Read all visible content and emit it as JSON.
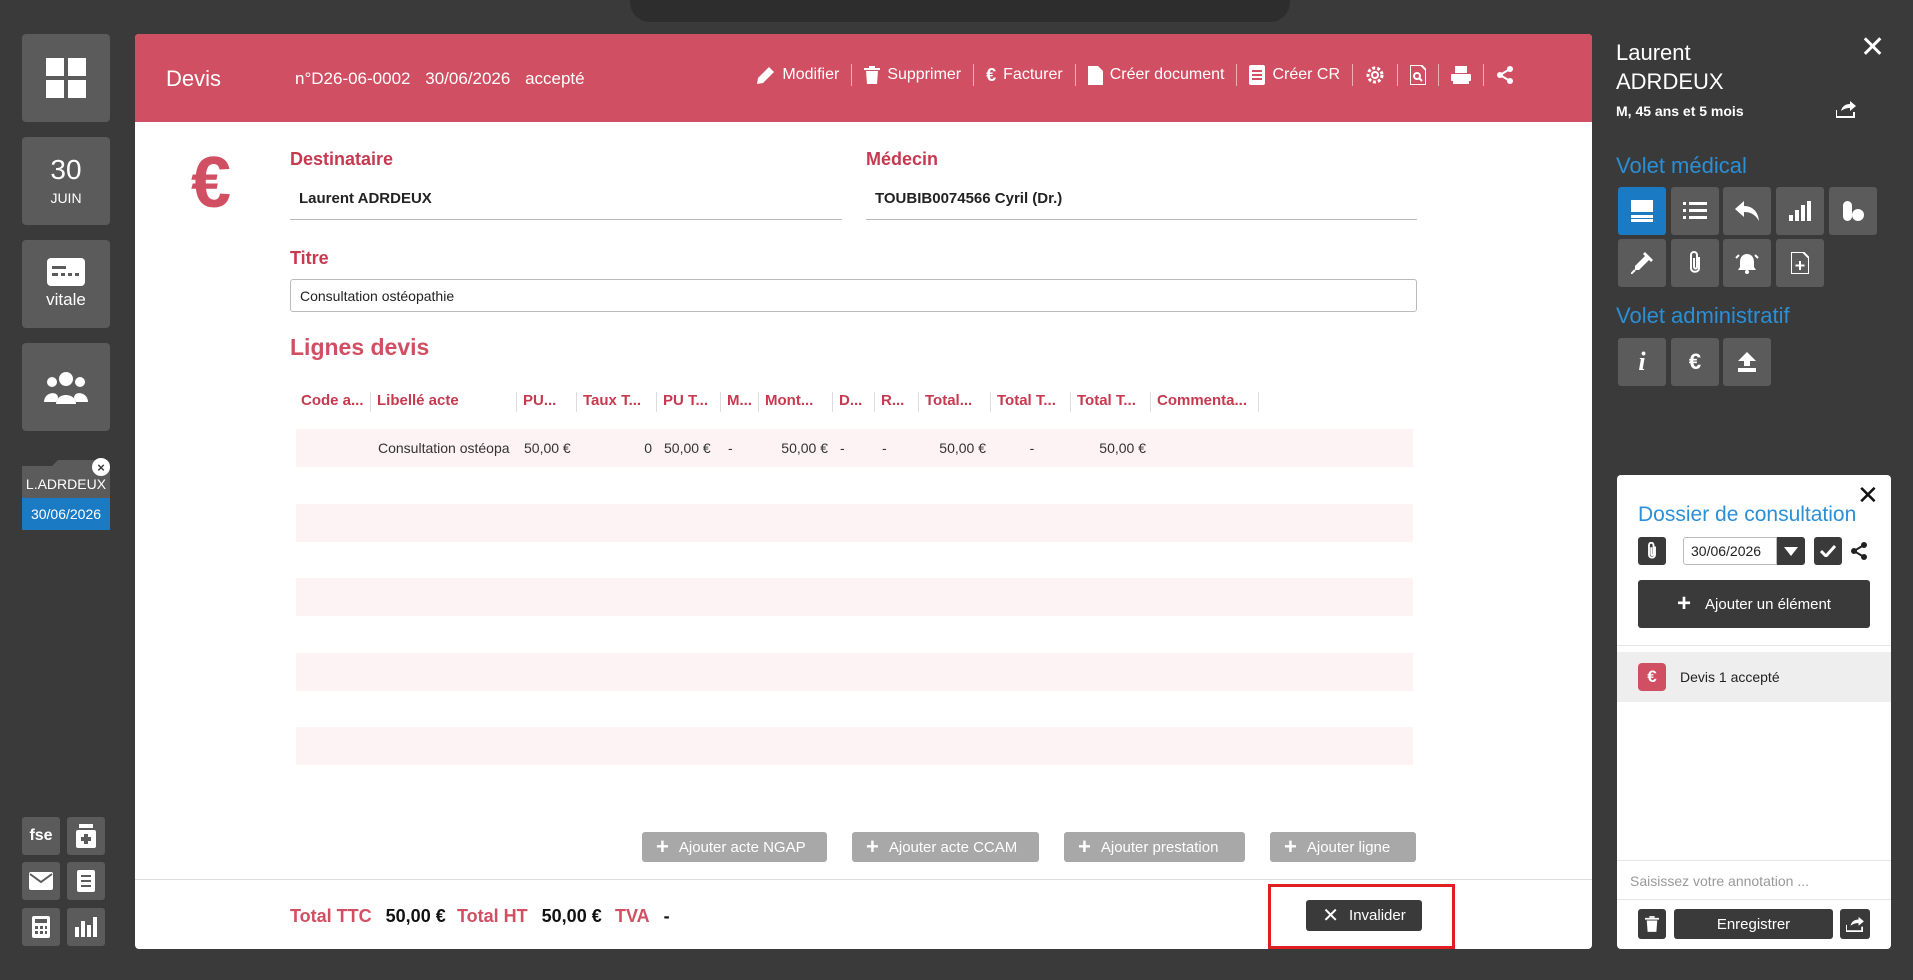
{
  "left_nav": {
    "day": "30",
    "month": "JUIN",
    "vitale_label": "vitale",
    "folder": {
      "name": "L.ADRDEUX",
      "date": "30/06/2026"
    },
    "fse_label": "fse"
  },
  "header": {
    "title": "Devis",
    "number": "n°D26-06-0002",
    "date": "30/06/2026",
    "status": "accepté",
    "actions": {
      "modifier": "Modifier",
      "supprimer": "Supprimer",
      "facturer": "Facturer",
      "creer_document": "Créer document",
      "creer_cr": "Créer CR"
    }
  },
  "form": {
    "destinataire_label": "Destinataire",
    "destinataire_value": "Laurent ADRDEUX",
    "medecin_label": "Médecin",
    "medecin_value": "TOUBIB0074566 Cyril (Dr.)",
    "titre_label": "Titre",
    "titre_value": "Consultation ostéopathie"
  },
  "lignes": {
    "title": "Lignes devis",
    "columns": [
      "Code a...",
      "Libellé acte",
      "PU...",
      "Taux T...",
      "PU T...",
      "M...",
      "Mont...",
      "D...",
      "R...",
      "Total...",
      "Total T...",
      "Total T...",
      "Commenta..."
    ],
    "rows": [
      [
        "",
        "Consultation ostéopa",
        "50,00 €",
        "0",
        "50,00 €",
        "-",
        "50,00 €",
        "-",
        "-",
        "50,00 €",
        "-",
        "50,00 €",
        ""
      ]
    ]
  },
  "add_buttons": {
    "ngap": "Ajouter acte NGAP",
    "ccam": "Ajouter acte CCAM",
    "prestation": "Ajouter prestation",
    "ligne": "Ajouter ligne"
  },
  "totals": {
    "ttc_label": "Total TTC",
    "ttc_value": "50,00 €",
    "ht_label": "Total HT",
    "ht_value": "50,00 €",
    "tva_label": "TVA",
    "tva_value": "-"
  },
  "invalider_label": "Invalider",
  "patient": {
    "first_name": "Laurent",
    "last_name": "ADRDEUX",
    "info": "M, 45 ans et 5 mois"
  },
  "volet_medical": "Volet médical",
  "volet_administratif": "Volet administratif",
  "dossier": {
    "title": "Dossier de consultation",
    "date": "30/06/2026",
    "add_label": "Ajouter un élément",
    "item_label": "Devis 1 accepté",
    "annotation_placeholder": "Saisissez votre annotation ...",
    "save_label": "Enregistrer"
  },
  "colors": {
    "accent": "#d14f62",
    "blue": "#1a7bc4",
    "link_blue": "#2b8fd6",
    "tile": "#5b5b5b",
    "bg": "#3a3a3a"
  }
}
